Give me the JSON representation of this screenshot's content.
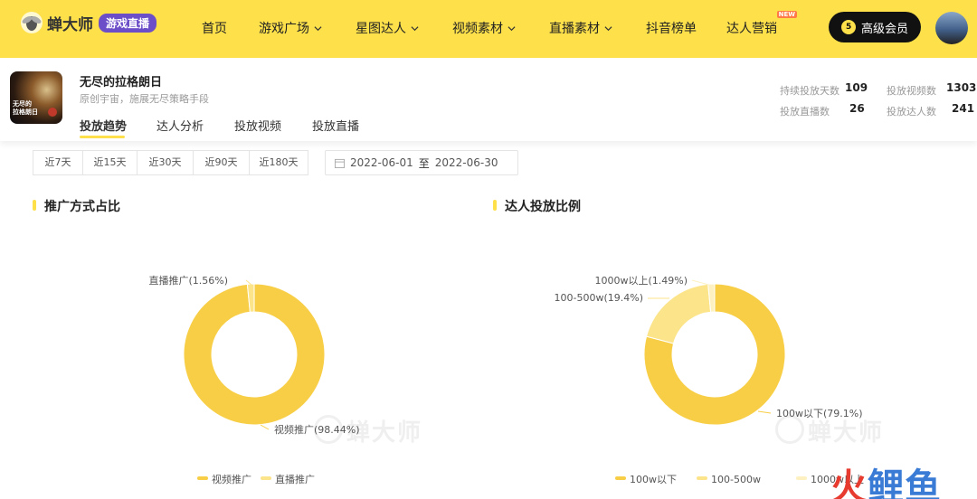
{
  "nav": {
    "brand": "蝉大师",
    "brand_badge": "游戏直播",
    "items": [
      {
        "label": "首页",
        "dropdown": false
      },
      {
        "label": "游戏广场",
        "dropdown": true
      },
      {
        "label": "星图达人",
        "dropdown": true
      },
      {
        "label": "视频素材",
        "dropdown": true
      },
      {
        "label": "直播素材",
        "dropdown": true
      },
      {
        "label": "抖音榜单",
        "dropdown": false
      },
      {
        "label": "达人营销",
        "dropdown": false,
        "badge": "NEW"
      }
    ],
    "vip_label": "高级会员",
    "vip_icon_text": "5"
  },
  "game": {
    "thumb_text": "无尽的\n拉格朗日",
    "title": "无尽的拉格朗日",
    "subtitle": "原创宇宙，施展无尽策略手段",
    "tabs": [
      "投放趋势",
      "达人分析",
      "投放视频",
      "投放直播"
    ],
    "active_tab": "投放趋势",
    "stats": [
      {
        "label": "持续投放天数",
        "value": "109"
      },
      {
        "label": "投放视频数",
        "value": "1303"
      },
      {
        "label": "投放直播数",
        "value": "26"
      },
      {
        "label": "投放达人数",
        "value": "241"
      }
    ]
  },
  "filters": {
    "ranges": [
      "近7天",
      "近15天",
      "近30天",
      "近90天",
      "近180天"
    ],
    "date_start": "2022-06-01",
    "date_sep": "至",
    "date_end": "2022-06-30"
  },
  "watermark": "蝉大师",
  "corner_watermark": {
    "part1": "火",
    "part2": "鲤鱼"
  },
  "colors": {
    "accent": "#fde04a",
    "series1": "#f7ce46",
    "series2": "#fce48b",
    "series3": "#fdf1c2"
  },
  "chart_data": [
    {
      "type": "pie",
      "donut": true,
      "title": "推广方式占比",
      "series": [
        {
          "name": "视频推广",
          "value": 98.44,
          "label": "视频推广(98.44%)"
        },
        {
          "name": "直播推广",
          "value": 1.56,
          "label": "直播推广(1.56%)"
        }
      ],
      "legend": [
        "视频推广",
        "直播推广"
      ],
      "legend_position": "bottom-center"
    },
    {
      "type": "pie",
      "donut": true,
      "title": "达人投放比例",
      "series": [
        {
          "name": "100w以下",
          "value": 79.1,
          "label": "100w以下(79.1%)"
        },
        {
          "name": "100-500w",
          "value": 19.4,
          "label": "100-500w(19.4%)"
        },
        {
          "name": "1000w以上",
          "value": 1.49,
          "label": "1000w以上(1.49%)"
        }
      ],
      "legend": [
        "100w以下",
        "100-500w",
        "1000w以上"
      ],
      "legend_position": "bottom-center"
    }
  ]
}
